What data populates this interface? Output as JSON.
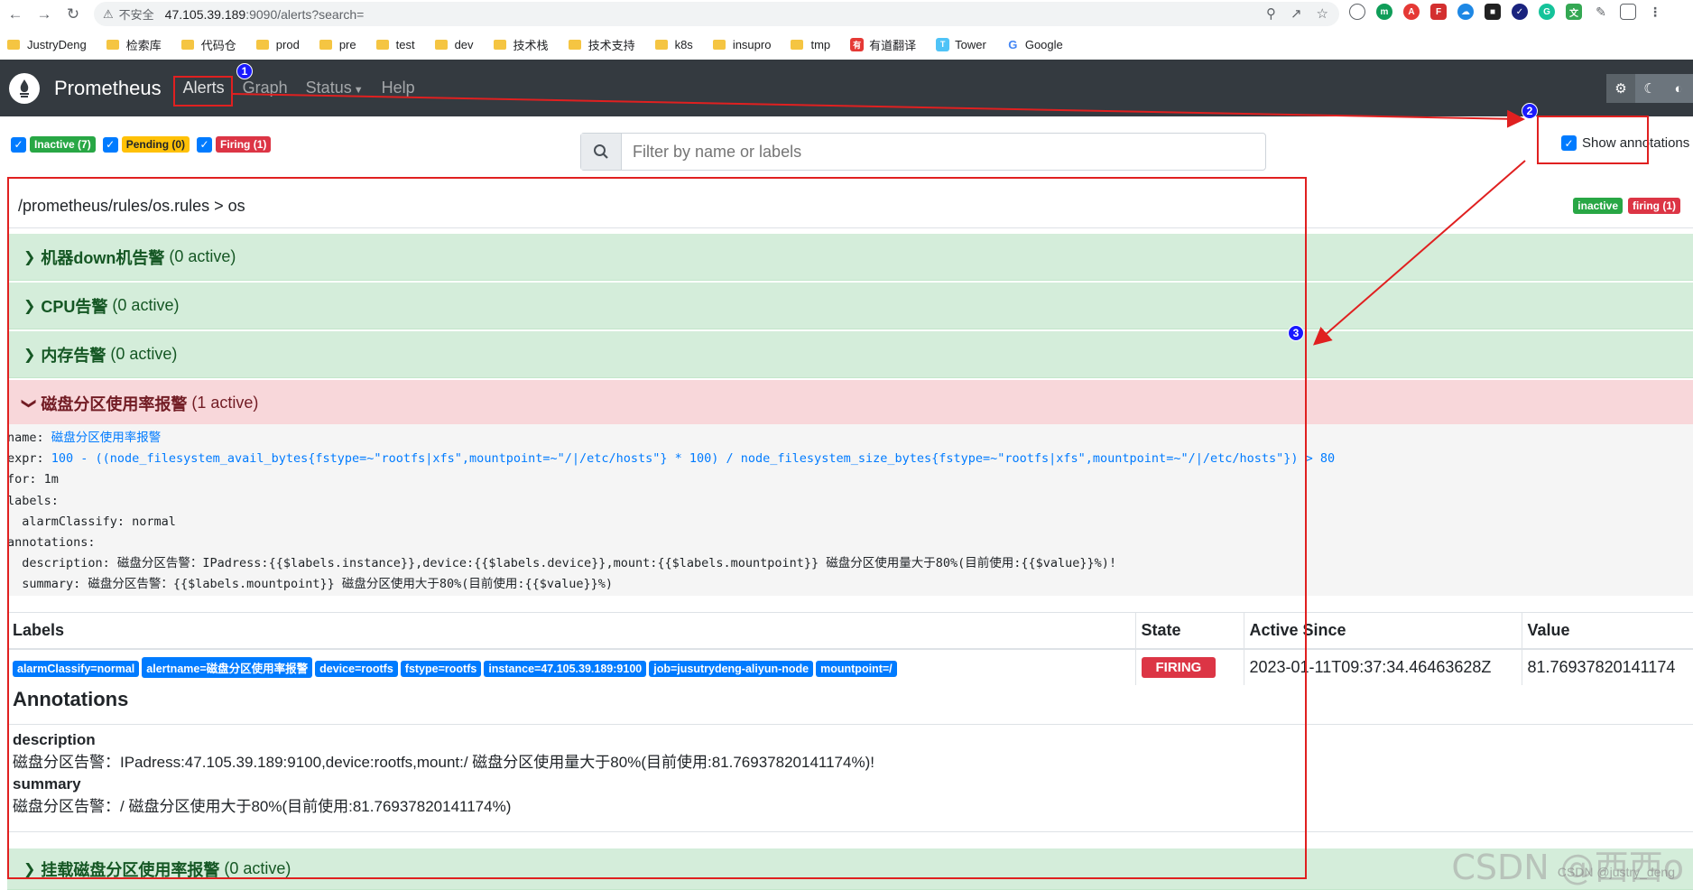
{
  "browser": {
    "insecure_label": "不安全",
    "url_host": "47.105.39.189",
    "url_path": ":9090/alerts?search=",
    "bookmarks": [
      "JustryDeng",
      "检索库",
      "代码仓",
      "prod",
      "pre",
      "test",
      "dev",
      "技术栈",
      "技术支持",
      "k8s",
      "insupro",
      "tmp",
      "有道翻译",
      "Tower",
      "Google"
    ]
  },
  "navbar": {
    "brand": "Prometheus",
    "links": [
      "Alerts",
      "Graph",
      "Status",
      "Help"
    ]
  },
  "filters": {
    "inactive": "Inactive (7)",
    "pending": "Pending (0)",
    "firing": "Firing (1)",
    "search_placeholder": "Filter by name or labels",
    "show_annotations": "Show annotations"
  },
  "rules_file": {
    "path": "/prometheus/rules/os.rules > os",
    "badge_inactive": "inactive",
    "badge_firing": "firing (1)"
  },
  "groups": [
    {
      "name": "机器down机告警",
      "count": "(0 active)"
    },
    {
      "name": "CPU告警",
      "count": "(0 active)"
    },
    {
      "name": "内存告警",
      "count": "(0 active)"
    },
    {
      "name": "磁盘分区使用率报警",
      "count": "(1 active)"
    },
    {
      "name": "挂载磁盘分区使用率报警",
      "count": "(0 active)"
    }
  ],
  "rule": {
    "name_key": "name: ",
    "name_val": "磁盘分区使用率报警",
    "expr_key": "expr: ",
    "expr_val": "100 - ((node_filesystem_avail_bytes{fstype=~\"rootfs|xfs\",mountpoint=~\"/|/etc/hosts\"} * 100) / node_filesystem_size_bytes{fstype=~\"rootfs|xfs\",mountpoint=~\"/|/etc/hosts\"}) > 80",
    "for_line": "for: 1m",
    "labels_line": "labels:",
    "label_line": "  alarmClassify: normal",
    "annotations_line": "annotations:",
    "desc_line": "  description: 磁盘分区告警：IPadress:{{$labels.instance}},device:{{$labels.device}},mount:{{$labels.mountpoint}} 磁盘分区使用量大于80%(目前使用:{{$value}}%)!",
    "summary_line": "  summary: 磁盘分区告警：{{$labels.mountpoint}} 磁盘分区使用大于80%(目前使用:{{$value}}%)"
  },
  "table": {
    "headers": [
      "Labels",
      "State",
      "Active Since",
      "Value"
    ],
    "labels": [
      "alarmClassify=normal",
      "alertname=磁盘分区使用率报警",
      "device=rootfs",
      "fstype=rootfs",
      "instance=47.105.39.189:9100",
      "job=jusutrydeng-aliyun-node",
      "mountpoint=/"
    ],
    "state": "FIRING",
    "active_since": "2023-01-11T09:37:34.46463628Z",
    "value": "81.76937820141174"
  },
  "annotations": {
    "title": "Annotations",
    "desc_key": "description",
    "desc_val": "磁盘分区告警：IPadress:47.105.39.189:9100,device:rootfs,mount:/ 磁盘分区使用量大于80%(目前使用:81.76937820141174%)!",
    "summary_key": "summary",
    "summary_val": "磁盘分区告警：/ 磁盘分区使用大于80%(目前使用:81.76937820141174%)"
  },
  "markers": [
    "1",
    "2",
    "3"
  ],
  "watermark": "CSDN @西西o",
  "watermark_sub": "CSDN @justry_deng",
  "colors": {
    "navbar": "#343a40",
    "inactive": "#28a745",
    "pending": "#ffc107",
    "firing": "#dc3545",
    "label": "#007bff",
    "annotation_box": "#e02020"
  }
}
